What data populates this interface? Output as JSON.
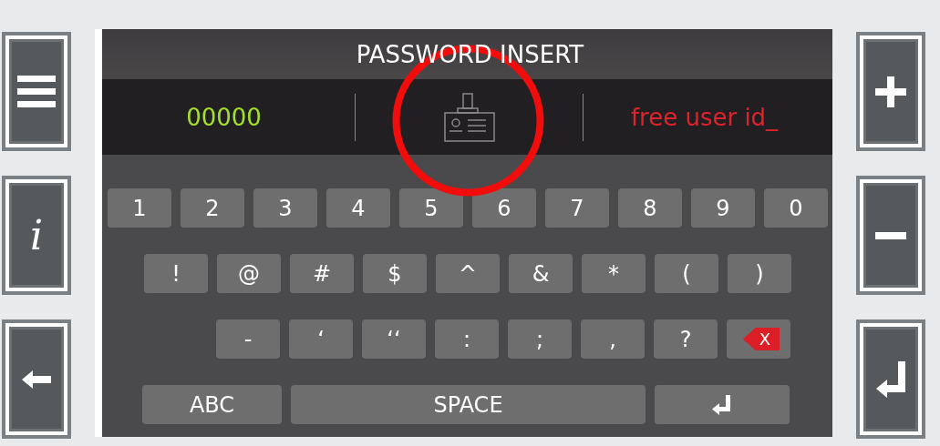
{
  "screen": {
    "title": "PASSWORD INSERT",
    "user_number": "00000",
    "user_id": "free user id_"
  },
  "left_buttons": [
    {
      "kind": "menu"
    },
    {
      "kind": "info",
      "label": "i"
    },
    {
      "kind": "back"
    }
  ],
  "right_buttons": [
    {
      "kind": "plus"
    },
    {
      "kind": "minus"
    },
    {
      "kind": "enter"
    }
  ],
  "keyboard": {
    "rows": [
      [
        {
          "kind": "char",
          "label": "1"
        },
        {
          "kind": "char",
          "label": "2"
        },
        {
          "kind": "char",
          "label": "3"
        },
        {
          "kind": "char",
          "label": "4"
        },
        {
          "kind": "char",
          "label": "5"
        },
        {
          "kind": "char",
          "label": "6"
        },
        {
          "kind": "char",
          "label": "7"
        },
        {
          "kind": "char",
          "label": "8"
        },
        {
          "kind": "char",
          "label": "9"
        },
        {
          "kind": "char",
          "label": "0"
        }
      ],
      [
        {
          "kind": "char",
          "label": "!"
        },
        {
          "kind": "char",
          "label": "@"
        },
        {
          "kind": "char",
          "label": "#"
        },
        {
          "kind": "char",
          "label": "$"
        },
        {
          "kind": "char",
          "label": "^"
        },
        {
          "kind": "char",
          "label": "&"
        },
        {
          "kind": "char",
          "label": "*"
        },
        {
          "kind": "char",
          "label": "("
        },
        {
          "kind": "char",
          "label": ")"
        }
      ],
      [
        {
          "kind": "char",
          "label": "-"
        },
        {
          "kind": "char",
          "label": "‘"
        },
        {
          "kind": "char",
          "label": "‘‘"
        },
        {
          "kind": "char",
          "label": ":"
        },
        {
          "kind": "char",
          "label": ";"
        },
        {
          "kind": "char",
          "label": ","
        },
        {
          "kind": "char",
          "label": "?"
        },
        {
          "kind": "backspace",
          "label": "X"
        }
      ],
      [
        {
          "kind": "mode",
          "label": "ABC"
        },
        {
          "kind": "space",
          "label": "SPACE"
        },
        {
          "kind": "enter"
        }
      ]
    ]
  }
}
